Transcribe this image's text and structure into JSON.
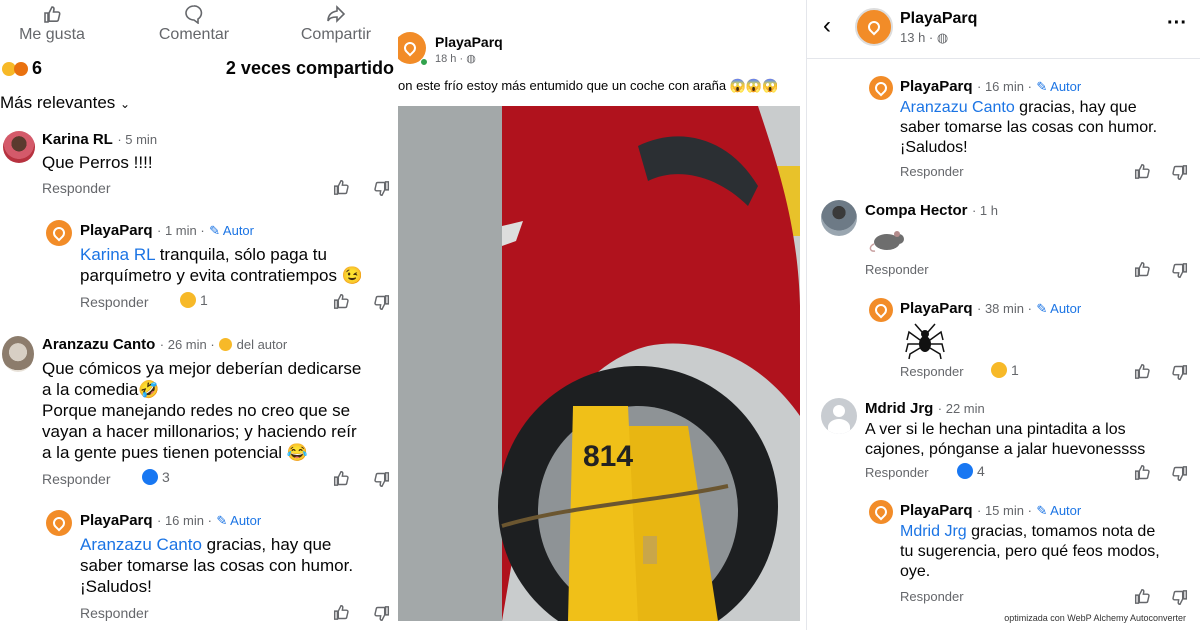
{
  "left": {
    "actions": {
      "like": "Me gusta",
      "comment": "Comentar",
      "share": "Compartir"
    },
    "reactions_count": "6",
    "shares": "2 veces compartido",
    "sort": "Más relevantes",
    "comments": [
      {
        "name": "Karina RL",
        "time": "· 5 min",
        "text": "Que Perros !!!!",
        "reply": "Responder"
      },
      {
        "name": "PlayaParq",
        "time": "· 1 min ·",
        "author": "Autor",
        "mention": "Karina RL",
        "text1": " tranquila, sólo paga tu",
        "text2": "parquímetro y evita contratiempos 😉",
        "reply": "Responder",
        "react": "1"
      },
      {
        "name": "Aranzazu Canto",
        "time": "· 26 min ·",
        "badge": "del autor",
        "lines": [
          "Que cómicos ya mejor deberían dedicarse",
          "a la comedia🤣",
          "Porque manejando redes no creo que se",
          "vayan a hacer millonarios; y haciendo reír",
          "a la gente pues tienen potencial 😂"
        ],
        "reply": "Responder",
        "react": "3"
      },
      {
        "name": "PlayaParq",
        "time": "· 16 min ·",
        "author": "Autor",
        "mention": "Aranzazu Canto",
        "text1": " gracias, hay que",
        "text2": "saber tomarse las cosas con humor.",
        "text3": "¡Saludos!",
        "reply": "Responder"
      }
    ]
  },
  "middle": {
    "page_name": "PlayaParq",
    "time": "18 h ·",
    "text": "on este frío estoy más entumido que un coche con araña 😱😱😱",
    "plate": "814"
  },
  "right": {
    "page_name": "PlayaParq",
    "time": "13 h ·",
    "comments": [
      {
        "name": "PlayaParq",
        "time": "· 16 min ·",
        "author": "Autor",
        "mention": "Aranzazu Canto",
        "text1": " gracias, hay que",
        "text2": "saber tomarse las cosas con humor.",
        "text3": "¡Saludos!",
        "reply": "Responder"
      },
      {
        "name": "Compa Hector",
        "time": "· 1 h",
        "reply": "Responder"
      },
      {
        "name": "PlayaParq",
        "time": "· 38 min ·",
        "author": "Autor",
        "reply": "Responder",
        "react": "1"
      },
      {
        "name": "Mdrid Jrg",
        "time": "· 22 min",
        "line1": "A ver si le hechan una pintadita a los",
        "line2": "cajones, pónganse a jalar huevonessss",
        "reply": "Responder",
        "react": "4"
      },
      {
        "name": "PlayaParq",
        "time": "· 15 min ·",
        "author": "Autor",
        "mention": "Mdrid Jrg",
        "text1": " gracias, tomamos nota de",
        "text2": "tu sugerencia, pero qué feos modos,",
        "text3": "oye.",
        "reply": "Responder"
      }
    ]
  },
  "watermark": "optimizada con WebP Alchemy Autoconverter"
}
